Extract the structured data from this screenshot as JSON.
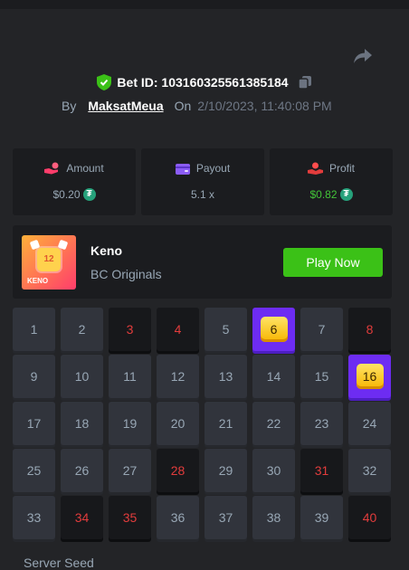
{
  "bet": {
    "id_label": "Bet ID: 103160325561385184",
    "by_label": "By",
    "user": "MaksatMeua",
    "on_label": "On",
    "date": "2/10/2023, 11:40:08 PM"
  },
  "stats": [
    {
      "label": "Amount",
      "value": "$0.20",
      "icon": "hand-coin-icon",
      "coin": "₮"
    },
    {
      "label": "Payout",
      "value": "5.1 x",
      "icon": "wallet-icon"
    },
    {
      "label": "Profit",
      "value": "$0.82",
      "icon": "profit-hand-icon",
      "coin": "₮"
    }
  ],
  "game": {
    "thumb_number": "12",
    "thumb_title": "KENO",
    "name": "Keno",
    "provider": "BC Originals",
    "play_label": "Play Now"
  },
  "grid": {
    "numbers": [
      "1",
      "2",
      "3",
      "4",
      "5",
      "6",
      "7",
      "8",
      "9",
      "10",
      "11",
      "12",
      "13",
      "14",
      "15",
      "16",
      "17",
      "18",
      "19",
      "20",
      "21",
      "22",
      "23",
      "24",
      "25",
      "26",
      "27",
      "28",
      "29",
      "30",
      "31",
      "32",
      "33",
      "34",
      "35",
      "36",
      "37",
      "38",
      "39",
      "40"
    ],
    "picked_miss": [
      3,
      4,
      8,
      28,
      31,
      34,
      35,
      40
    ],
    "picked_hit": [
      6,
      16
    ]
  },
  "footer": {
    "server_seed_label": "Server Seed"
  },
  "colors": {
    "accent_green": "#3bc117",
    "hit_purple": "#6d2cf2",
    "miss_red": "#e23c3c"
  }
}
